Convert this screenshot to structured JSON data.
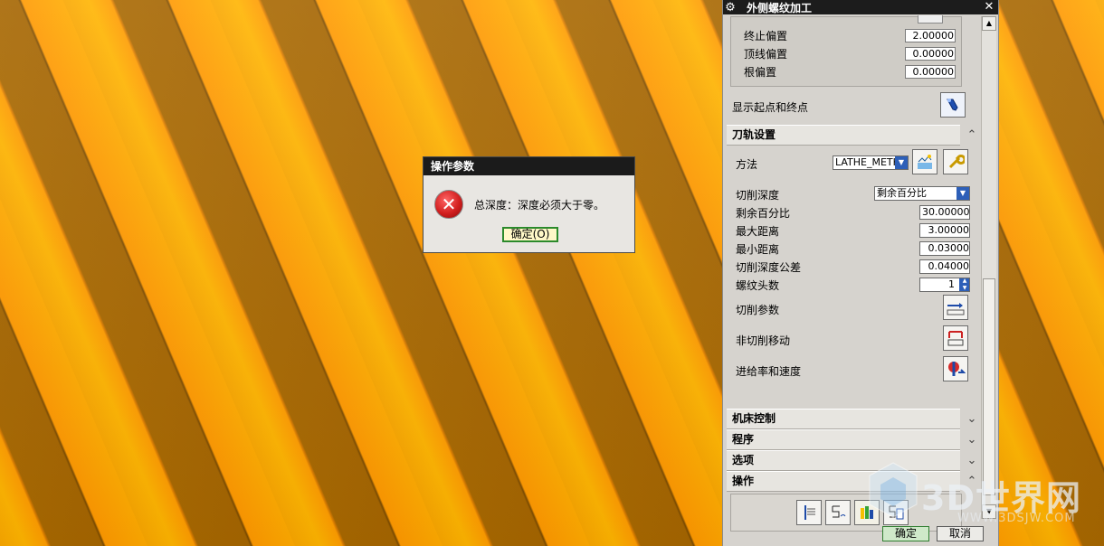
{
  "panel": {
    "title": "外侧螺纹加工",
    "offsets": [
      {
        "label": "终止偏置",
        "value": "2.00000"
      },
      {
        "label": "顶线偏置",
        "value": "0.00000"
      },
      {
        "label": "根偏置",
        "value": "0.00000"
      }
    ],
    "show_points_label": "显示起点和终点",
    "path_section": {
      "title": "刀轨设置",
      "method_label": "方法",
      "method_value": "LATHE_METHO",
      "cut_depth_label": "切削深度",
      "cut_depth_value": "剩余百分比",
      "fields": [
        {
          "label": "剩余百分比",
          "value": "30.00000"
        },
        {
          "label": "最大距离",
          "value": "3.00000"
        },
        {
          "label": "最小距离",
          "value": "0.03000"
        },
        {
          "label": "切削深度公差",
          "value": "0.04000"
        }
      ],
      "thread_count_label": "螺纹头数",
      "thread_count_value": "1",
      "cut_params_label": "切削参数",
      "non_cut_label": "非切削移动",
      "feed_speed_label": "进给率和速度"
    },
    "sections": [
      {
        "title": "机床控制"
      },
      {
        "title": "程序"
      },
      {
        "title": "选项"
      },
      {
        "title": "操作"
      }
    ],
    "ok_label": "确定",
    "cancel_label": "取消"
  },
  "dialog": {
    "title": "操作参数",
    "message": "总深度：深度必须大于零。",
    "ok_label": "确定(O)"
  },
  "watermark": {
    "text": "3D世界网",
    "url": "WWW.3DSJW.COM"
  }
}
